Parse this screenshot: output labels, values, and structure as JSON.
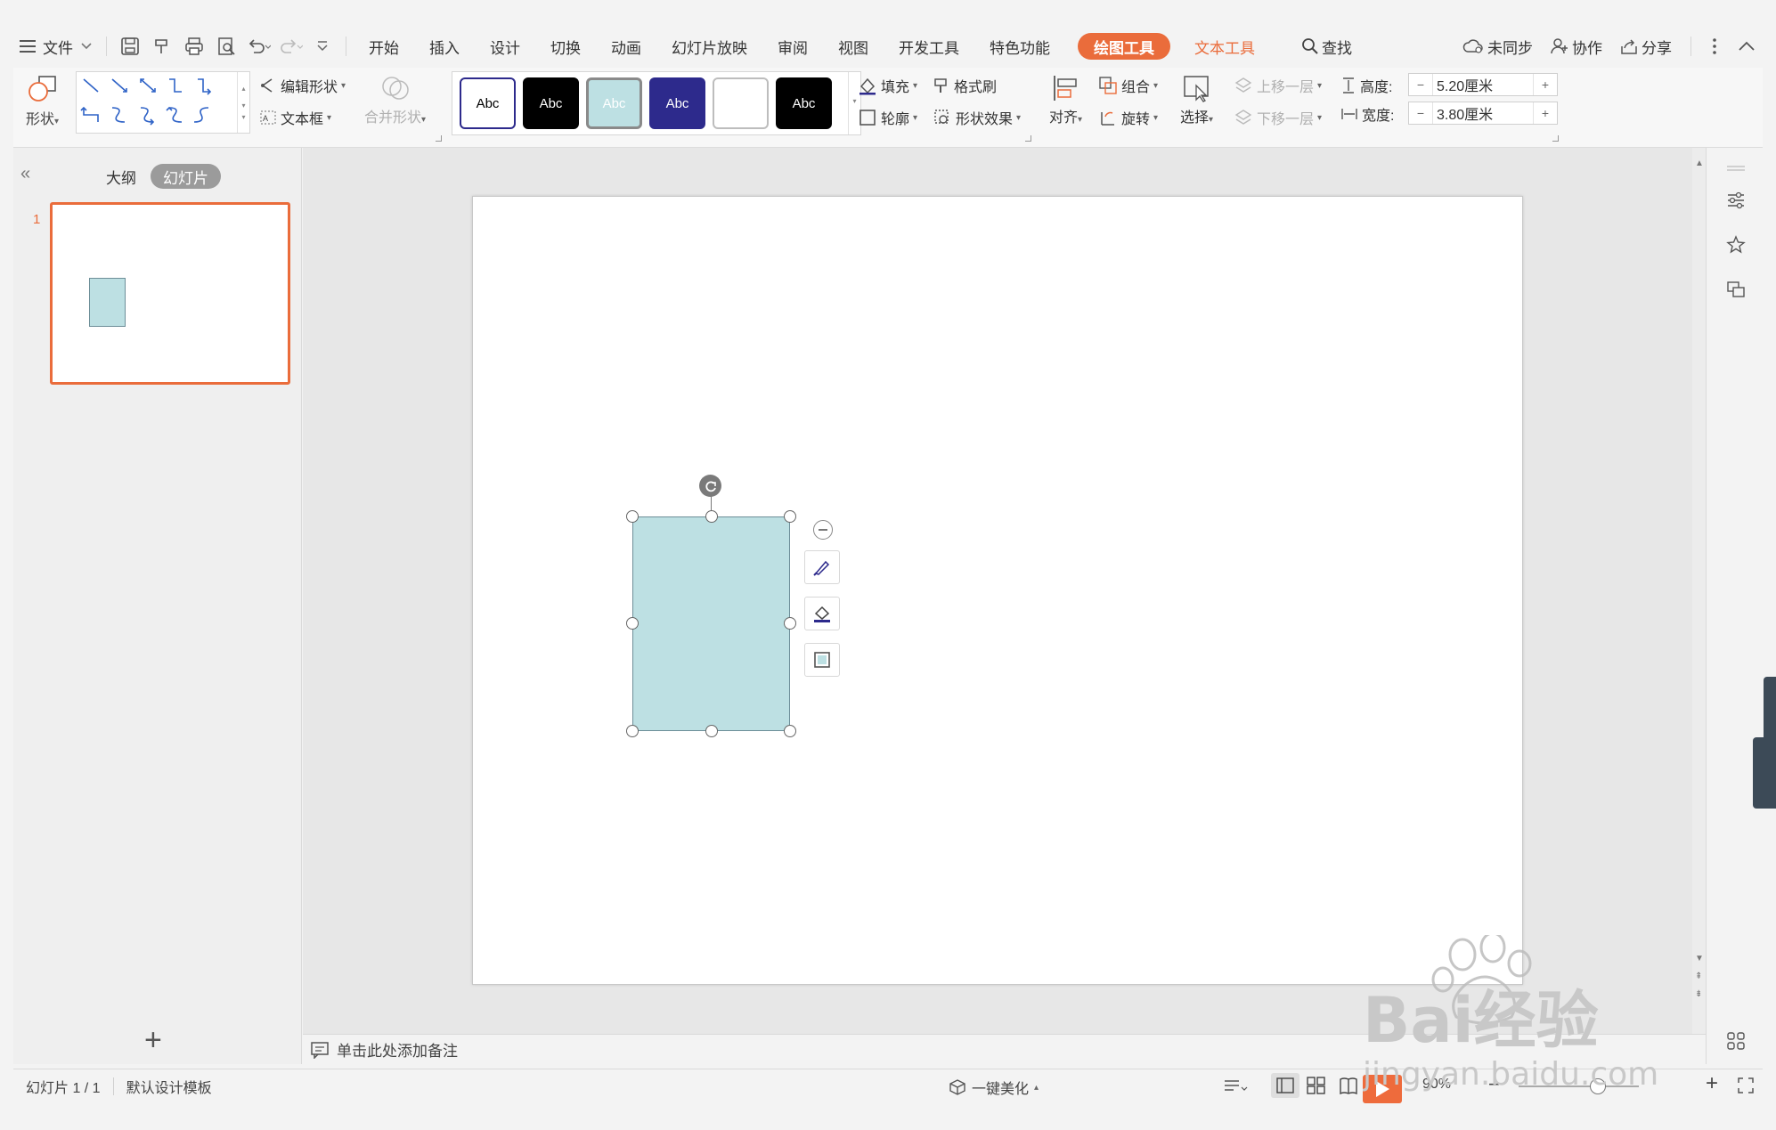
{
  "menubar": {
    "file_label": "文件",
    "tabs": [
      "开始",
      "插入",
      "设计",
      "切换",
      "动画",
      "幻灯片放映",
      "审阅",
      "视图",
      "开发工具",
      "特色功能"
    ],
    "active_tab": "绘图工具",
    "text_tool_tab": "文本工具",
    "search_label": "查找",
    "sync_label": "未同步",
    "collab_label": "协作",
    "share_label": "分享"
  },
  "ribbon": {
    "shape_label": "形状",
    "edit_shape_label": "编辑形状",
    "textbox_label": "文本框",
    "merge_shape_label": "合并形状",
    "style_swatches": [
      {
        "text": "Abc",
        "bg": "#ffffff",
        "fg": "#000000",
        "border": "#2d2a8c"
      },
      {
        "text": "Abc",
        "bg": "#000000",
        "fg": "#ffffff",
        "border": "#000000"
      },
      {
        "text": "Abc",
        "bg": "#bde0e3",
        "fg": "#ffffff",
        "border": "#8a8a8a"
      },
      {
        "text": "Abc",
        "bg": "#2d2a8c",
        "fg": "#ffffff",
        "border": "#2d2a8c"
      },
      {
        "text": "",
        "bg": "#ffffff",
        "fg": "#ffffff",
        "border": "#bdbdbd"
      },
      {
        "text": "Abc",
        "bg": "#000000",
        "fg": "#ffffff",
        "border": "#000000"
      }
    ],
    "fill_label": "填充",
    "format_painter_label": "格式刷",
    "outline_label": "轮廓",
    "shape_effect_label": "形状效果",
    "align_label": "对齐",
    "group_label": "组合",
    "rotate_label": "旋转",
    "select_label": "选择",
    "bring_forward_label": "上移一层",
    "send_backward_label": "下移一层",
    "height_label": "高度:",
    "height_value": "5.20厘米",
    "width_label": "宽度:",
    "width_value": "3.80厘米"
  },
  "leftpanel": {
    "outline_tab": "大纲",
    "slides_tab": "幻灯片",
    "slide_number": "1"
  },
  "notes": {
    "placeholder": "单击此处添加备注"
  },
  "statusbar": {
    "slide_counter": "幻灯片 1 / 1",
    "template_name": "默认设计模板",
    "beautify_label": "一键美化",
    "zoom_value": "90%"
  },
  "colors": {
    "accent": "#ea6c3b",
    "shape_fill": "#bde0e3",
    "shape_border": "#6d8e98"
  },
  "watermark": {
    "brand": "Bai经验",
    "url": "jingyan.baidu.com"
  }
}
